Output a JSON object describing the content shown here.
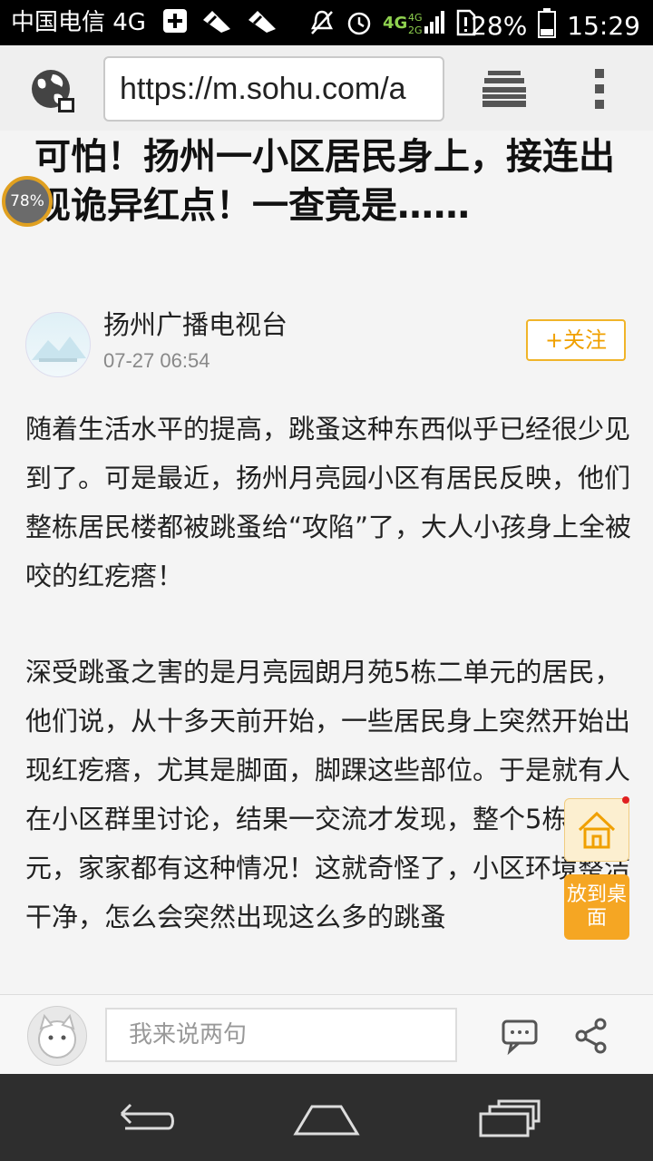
{
  "status_bar": {
    "carrier": "中国电信 4G",
    "network_badge": "4G",
    "battery": "28%",
    "time": "15:29"
  },
  "browser": {
    "url": "https://m.sohu.com/a"
  },
  "article": {
    "title": "可怕！扬州一小区居民身上，接连出现诡异红点！一查竟是……",
    "reading_progress": "78%",
    "author": "扬州广播电视台",
    "date": "07-27 06:54",
    "follow_label": "+关注",
    "paragraphs": [
      "随着生活水平的提高，跳蚤这种东西似乎已经很少见到了。可是最近，扬州月亮园小区有居民反映，他们整栋居民楼都被跳蚤给“攻陷”了，大人小孩身上全被咬的红疙瘩！",
      "深受跳蚤之害的是月亮园朗月苑5栋二单元的居民，他们说，从十多天前开始，一些居民身上突然开始出现红疙瘩，尤其是脚面，脚踝这些部位。于是就有人在小区群里讨论，结果一交流才发现，整个5栋二单元，家家都有这种情况！这就奇怪了，小区环境整洁干净，怎么会突然出现这么多的跳蚤"
    ]
  },
  "floating": {
    "desktop_label": "放到桌面"
  },
  "comment_bar": {
    "placeholder": "我来说两句"
  },
  "colors": {
    "accent": "#f5a623",
    "follow_border": "#f0b429",
    "navbar": "#2e2e2e"
  },
  "icons": [
    "globe-icon",
    "tabs-icon",
    "more-vert-icon",
    "home-icon",
    "comment-icon",
    "share-icon",
    "back-icon",
    "home-nav-icon",
    "recent-apps-icon"
  ]
}
